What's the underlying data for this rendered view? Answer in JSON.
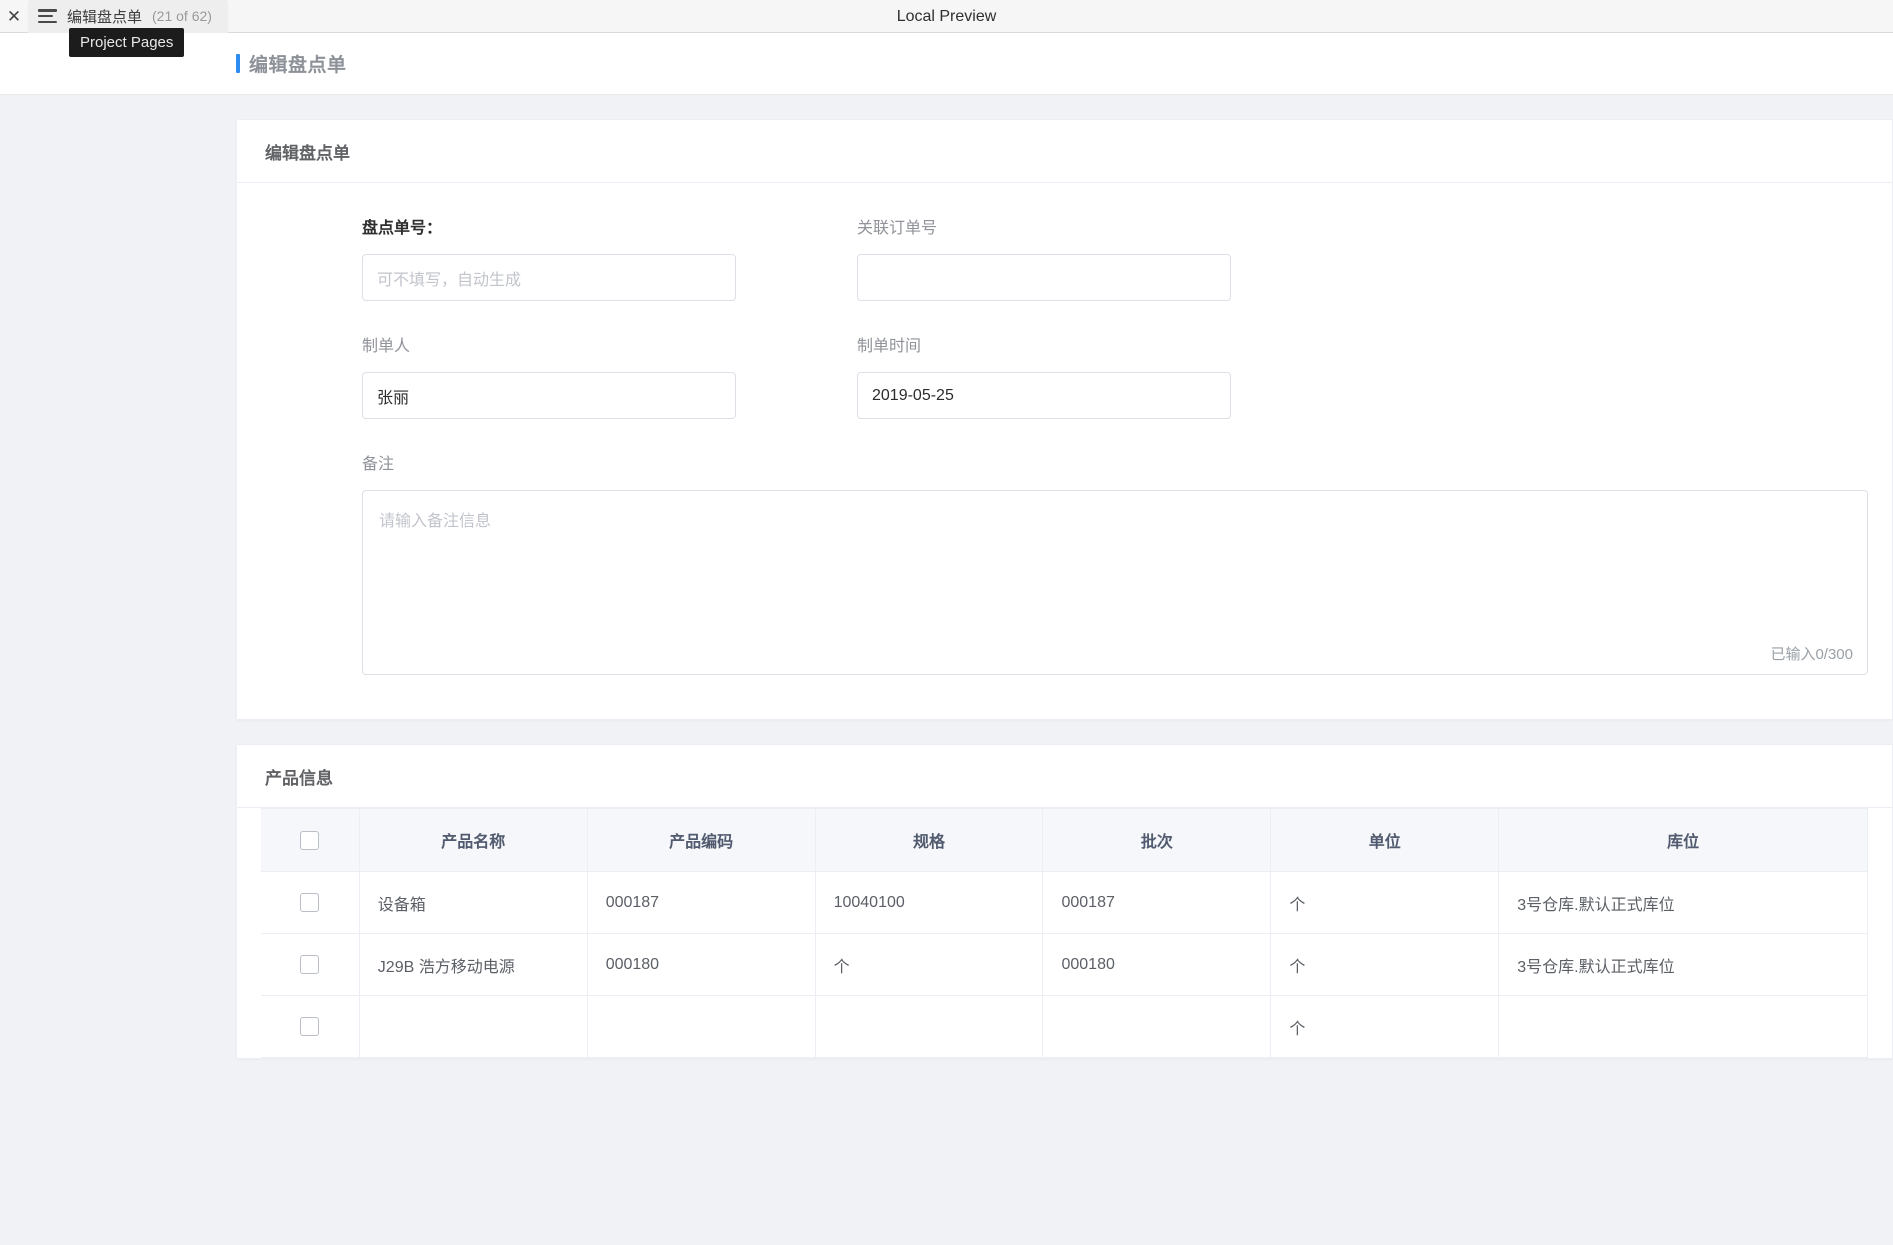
{
  "topbar": {
    "close_icon": "close-icon",
    "menu_icon": "hamburger-menu-icon",
    "tab_title": "编辑盘点单",
    "tab_count": "(21 of 62)",
    "preview_label": "Local Preview",
    "tooltip": "Project Pages"
  },
  "page_header": {
    "title": "编辑盘点单",
    "accent_color": "#2d8cf0"
  },
  "form_card": {
    "title": "编辑盘点单",
    "fields": {
      "order_no": {
        "label": "盘点单号：",
        "value": "",
        "placeholder": "可不填写，自动生成"
      },
      "related_order_no": {
        "label": "关联订单号",
        "value": "",
        "placeholder": ""
      },
      "creator": {
        "label": "制单人",
        "value": "张丽",
        "placeholder": ""
      },
      "create_time": {
        "label": "制单时间",
        "value": "2019-05-25",
        "placeholder": ""
      },
      "remark": {
        "label": "备注",
        "value": "",
        "placeholder": "请输入备注信息",
        "counter": "已输入0/300"
      }
    }
  },
  "product_card": {
    "title": "产品信息",
    "table": {
      "select_all_checkbox": "unchecked",
      "columns": [
        "",
        "产品名称",
        "产品编码",
        "规格",
        "批次",
        "单位",
        "库位"
      ],
      "rows": [
        {
          "checked": false,
          "name": "设备箱",
          "code": "000187",
          "spec": "10040100",
          "batch": "000187",
          "unit": "个",
          "location": "3号仓库.默认正式库位"
        },
        {
          "checked": false,
          "name": "J29B 浩方移动电源",
          "code": "000180",
          "spec": "个",
          "batch": "000180",
          "unit": "个",
          "location": "3号仓库.默认正式库位"
        },
        {
          "checked": false,
          "name": "",
          "code": "",
          "spec": "",
          "batch": "",
          "unit": "个",
          "location": ""
        }
      ]
    }
  }
}
